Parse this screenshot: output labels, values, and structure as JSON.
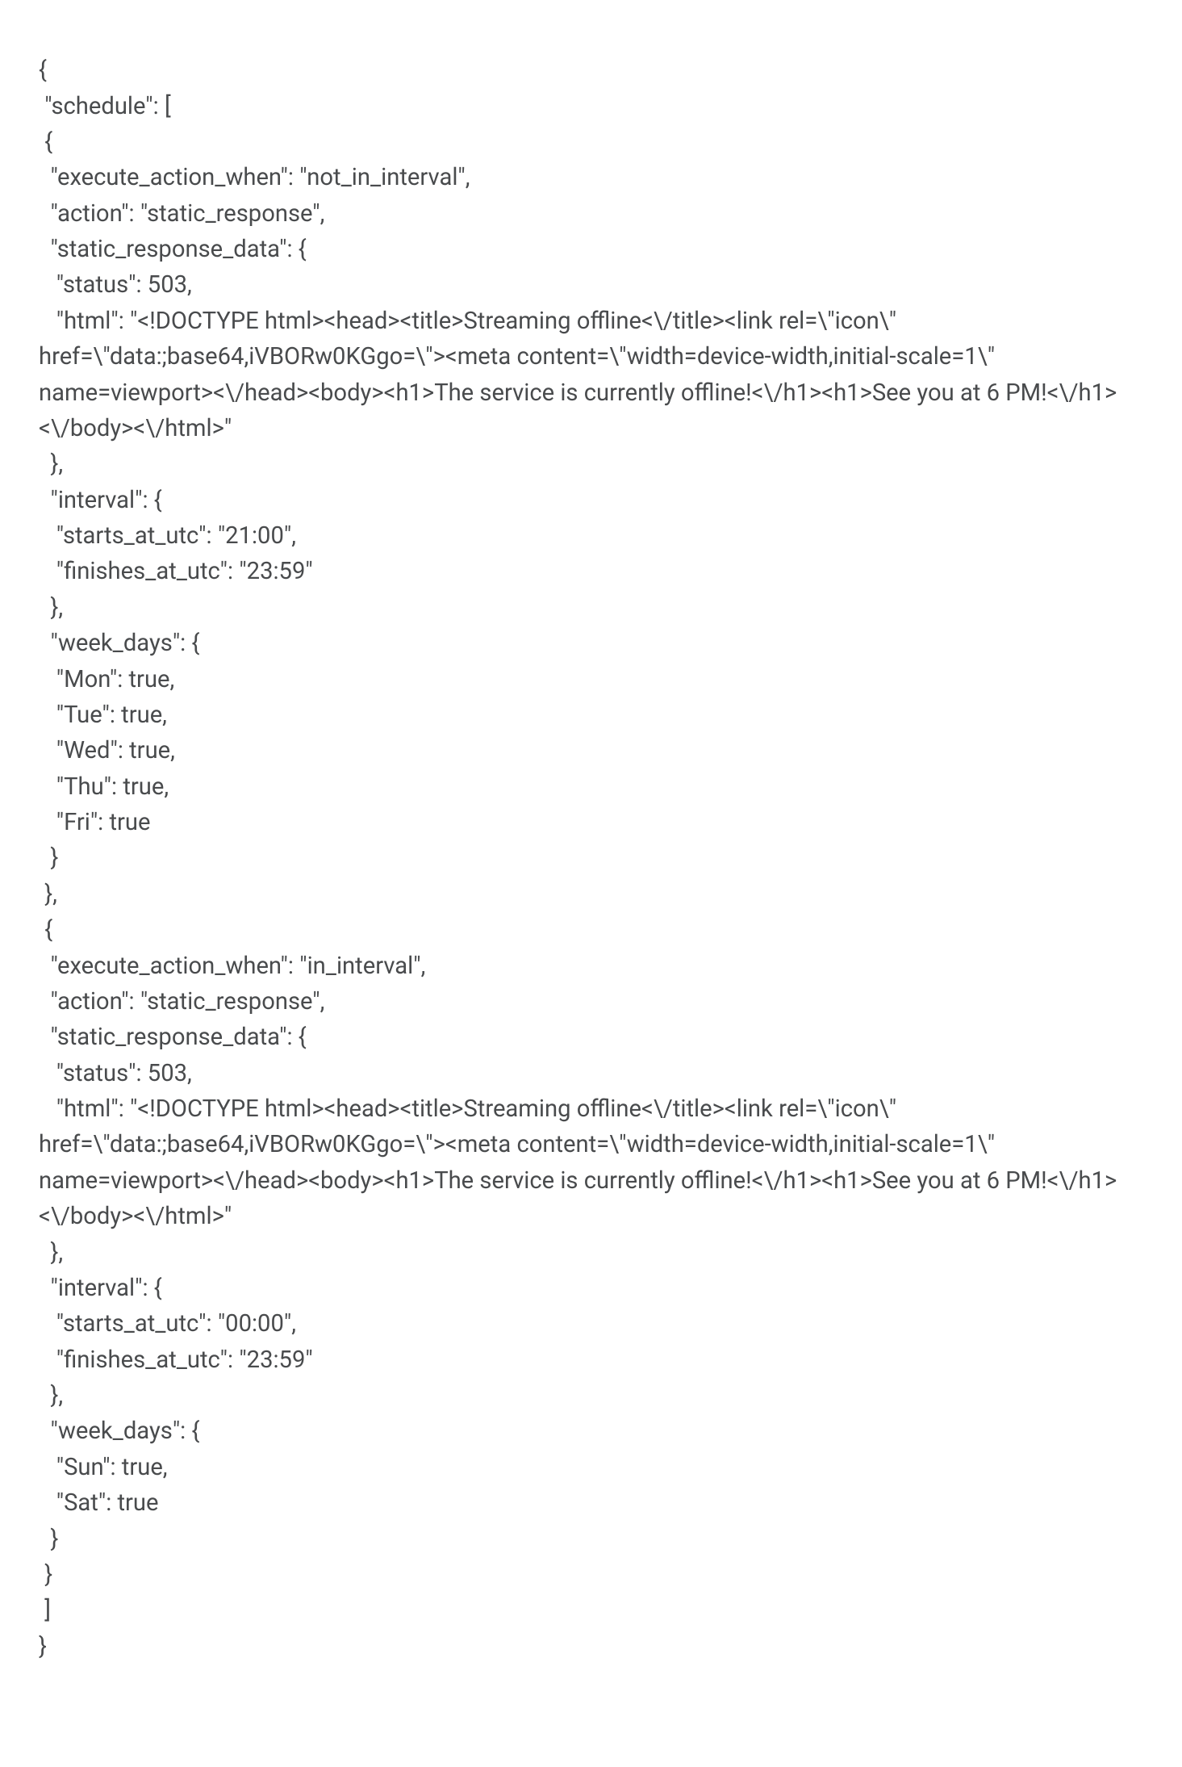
{
  "code": {
    "lines": [
      "{",
      " \"schedule\": [",
      " {",
      "  \"execute_action_when\": \"not_in_interval\",",
      "  \"action\": \"static_response\",",
      "  \"static_response_data\": {",
      "   \"status\": 503,",
      "   \"html\": \"<!DOCTYPE html><head><title>Streaming offline<\\/title><link rel=\\\"icon\\\" href=\\\"data:;base64,iVBORw0KGgo=\\\"><meta content=\\\"width=device-width,initial-scale=1\\\" name=viewport><\\/head><body><h1>The service is currently offline!<\\/h1><h1>See you at 6 PM!<\\/h1><\\/body><\\/html>\"",
      "  },",
      "  \"interval\": {",
      "   \"starts_at_utc\": \"21:00\",",
      "   \"finishes_at_utc\": \"23:59\"",
      "  },",
      "  \"week_days\": {",
      "   \"Mon\": true,",
      "   \"Tue\": true,",
      "   \"Wed\": true,",
      "   \"Thu\": true,",
      "   \"Fri\": true",
      "  }",
      " },",
      " {",
      "  \"execute_action_when\": \"in_interval\",",
      "  \"action\": \"static_response\",",
      "  \"static_response_data\": {",
      "   \"status\": 503,",
      "   \"html\": \"<!DOCTYPE html><head><title>Streaming offline<\\/title><link rel=\\\"icon\\\" href=\\\"data:;base64,iVBORw0KGgo=\\\"><meta content=\\\"width=device-width,initial-scale=1\\\" name=viewport><\\/head><body><h1>The service is currently offline!<\\/h1><h1>See you at 6 PM!<\\/h1><\\/body><\\/html>\"",
      "  },",
      "  \"interval\": {",
      "   \"starts_at_utc\": \"00:00\",",
      "   \"finishes_at_utc\": \"23:59\"",
      "  },",
      "  \"week_days\": {",
      "   \"Sun\": true,",
      "   \"Sat\": true",
      "  }",
      " }",
      " ]",
      "}"
    ]
  }
}
